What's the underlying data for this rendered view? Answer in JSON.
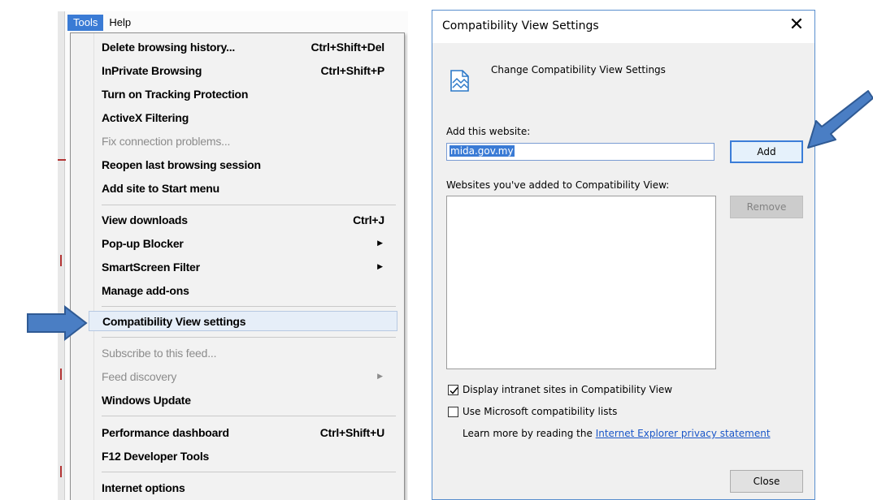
{
  "menubar": {
    "tools_label": "Tools",
    "help_label": "Help"
  },
  "tools_menu": {
    "items": [
      {
        "label": "Delete browsing history...",
        "shortcut": "Ctrl+Shift+Del"
      },
      {
        "label": "InPrivate Browsing",
        "shortcut": "Ctrl+Shift+P"
      },
      {
        "label": "Turn on Tracking Protection",
        "shortcut": ""
      },
      {
        "label": "ActiveX Filtering",
        "shortcut": ""
      },
      {
        "label": "Fix connection problems...",
        "shortcut": "",
        "disabled": true
      },
      {
        "label": "Reopen last browsing session",
        "shortcut": ""
      },
      {
        "label": "Add site to Start menu",
        "shortcut": ""
      },
      {
        "label": "View downloads",
        "shortcut": "Ctrl+J"
      },
      {
        "label": "Pop-up Blocker",
        "shortcut": "",
        "submenu": true
      },
      {
        "label": "SmartScreen Filter",
        "shortcut": "",
        "submenu": true
      },
      {
        "label": "Manage add-ons",
        "shortcut": ""
      },
      {
        "label": "Compatibility View settings",
        "shortcut": "",
        "highlighted": true
      },
      {
        "label": "Subscribe to this feed...",
        "shortcut": "",
        "disabled": true
      },
      {
        "label": "Feed discovery",
        "shortcut": "",
        "disabled": true,
        "submenu": true
      },
      {
        "label": "Windows Update",
        "shortcut": ""
      },
      {
        "label": "Performance dashboard",
        "shortcut": "Ctrl+Shift+U"
      },
      {
        "label": "F12 Developer Tools",
        "shortcut": ""
      },
      {
        "label": "Internet options",
        "shortcut": ""
      }
    ]
  },
  "dialog": {
    "title": "Compatibility View Settings",
    "heading": "Change Compatibility View Settings",
    "add_site_label": "Add this website:",
    "add_site_value": "mida.gov.my",
    "add_button": "Add",
    "list_label": "Websites you've added to Compatibility View:",
    "remove_button": "Remove",
    "display_intranet_label": "Display intranet sites in Compatibility View",
    "display_intranet_checked": true,
    "ms_lists_label": "Use Microsoft compatibility lists",
    "ms_lists_checked": false,
    "learn_more_prefix": "Learn more by reading the ",
    "privacy_link": "Internet Explorer privacy statement",
    "close_button": "Close"
  },
  "colors": {
    "menu_active": "#3a7bd5",
    "arrow_fill": "#4a7ec4",
    "arrow_stroke": "#2f5a94",
    "dialog_border": "#5a8fce",
    "link": "#1a56c8"
  },
  "icons": {
    "dialog_header": "page-image-icon",
    "submenu": "chevron-right-icon",
    "close": "close-icon",
    "checkbox": "checkmark-icon"
  }
}
